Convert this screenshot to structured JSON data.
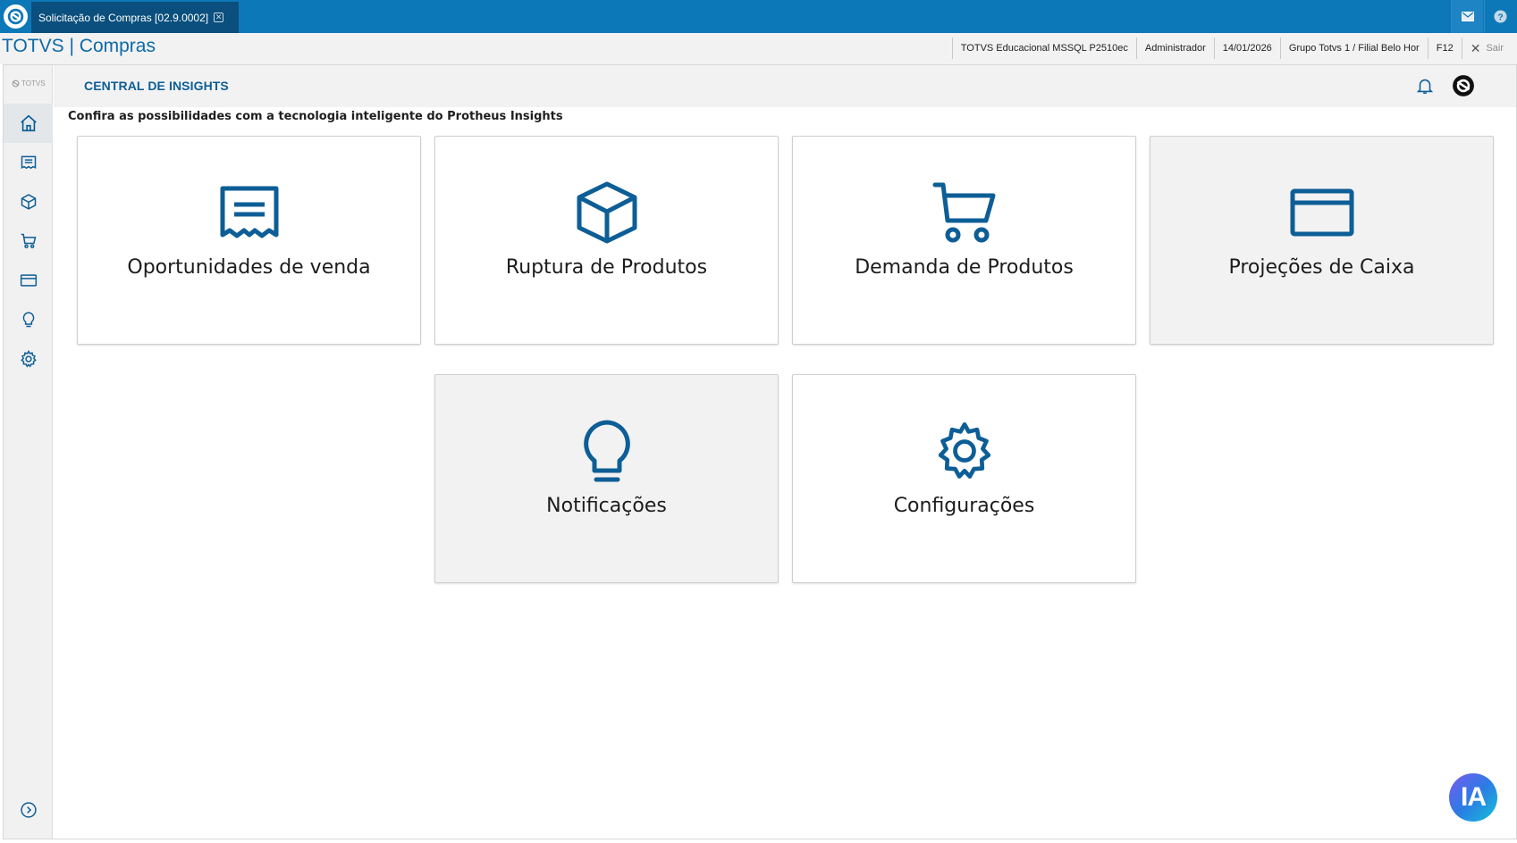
{
  "window": {
    "tab_title": "Solicitação de Compras [02.9.0002]",
    "tab_close": "✕"
  },
  "header": {
    "brand_name": "TOTVS",
    "brand_separator": "|",
    "module": "Compras",
    "environment": "TOTVS Educacional MSSQL P2510ec",
    "user": "Administrador",
    "date": "14/01/2026",
    "branch": "Grupo Totvs 1 / Filial Belo Hor",
    "shortcut": "F12",
    "exit_label": "Sair"
  },
  "sidebar": {
    "logo_text": "TOTVS",
    "items": [
      {
        "icon": "home-icon",
        "active": true
      },
      {
        "icon": "receipt-icon",
        "active": false
      },
      {
        "icon": "box-icon",
        "active": false
      },
      {
        "icon": "cart-icon",
        "active": false
      },
      {
        "icon": "card-icon",
        "active": false
      },
      {
        "icon": "lightbulb-icon",
        "active": false
      },
      {
        "icon": "gear-icon",
        "active": false
      }
    ],
    "expand_icon": "chevron-right-circle-icon"
  },
  "main": {
    "section_title": "CENTRAL DE INSIGHTS",
    "subtitle": "Confira as possibilidades com a tecnologia inteligente do Protheus Insights",
    "cards": [
      {
        "label": "Oportunidades de venda",
        "icon": "receipt-icon"
      },
      {
        "label": "Ruptura de Produtos",
        "icon": "box-icon"
      },
      {
        "label": "Demanda de Produtos",
        "icon": "cart-icon"
      },
      {
        "label": "Projeções de Caixa",
        "icon": "card-icon"
      },
      {
        "label": "Notificações",
        "icon": "lightbulb-icon"
      },
      {
        "label": "Configurações",
        "icon": "gear-icon"
      }
    ]
  },
  "assistant": {
    "label": "IA"
  },
  "colors": {
    "topbar": "#0d78b8",
    "tab": "#0a4f7d",
    "accent": "#0d5e96",
    "icon": "#0d5e96"
  }
}
